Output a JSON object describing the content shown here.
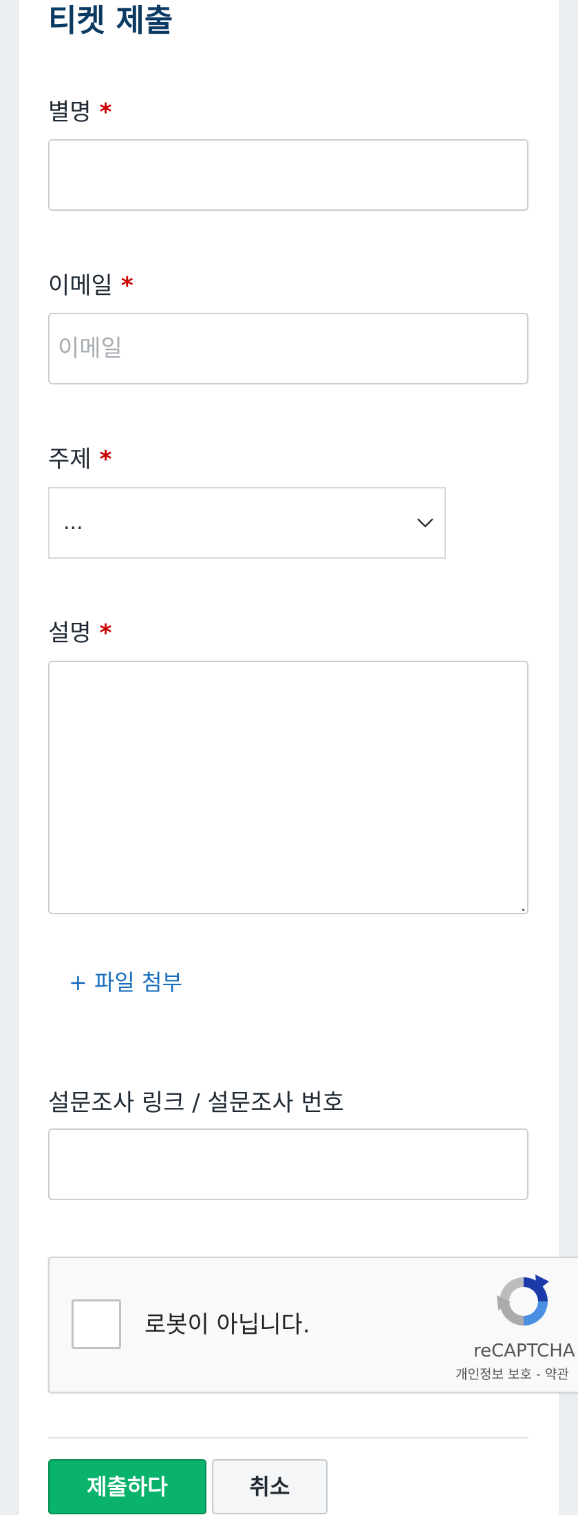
{
  "form": {
    "title": "티켓 제출",
    "required_marker": "*",
    "nickname": {
      "label": "별명",
      "value": "",
      "placeholder": ""
    },
    "email": {
      "label": "이메일",
      "value": "",
      "placeholder": "이메일"
    },
    "subject": {
      "label": "주제",
      "selected": "..."
    },
    "description": {
      "label": "설명",
      "value": ""
    },
    "attach_label": "+ 파일 첨부",
    "survey": {
      "label": "설문조사 링크 / 설문조사 번호",
      "value": ""
    }
  },
  "recaptcha": {
    "label": "로봇이 아닙니다.",
    "brand": "reCAPTCHA",
    "privacy": "개인정보 보호",
    "separator": " - ",
    "terms": "약관"
  },
  "actions": {
    "submit_label": "제출하다",
    "cancel_label": "취소"
  },
  "colors": {
    "title": "#0b3a63",
    "required": "#cc0000",
    "link": "#1a6dbd",
    "submit_bg": "#0ab36b"
  },
  "icons": {
    "select_arrow": "chevron-down-icon",
    "recaptcha_logo": "recaptcha-logo-icon"
  }
}
